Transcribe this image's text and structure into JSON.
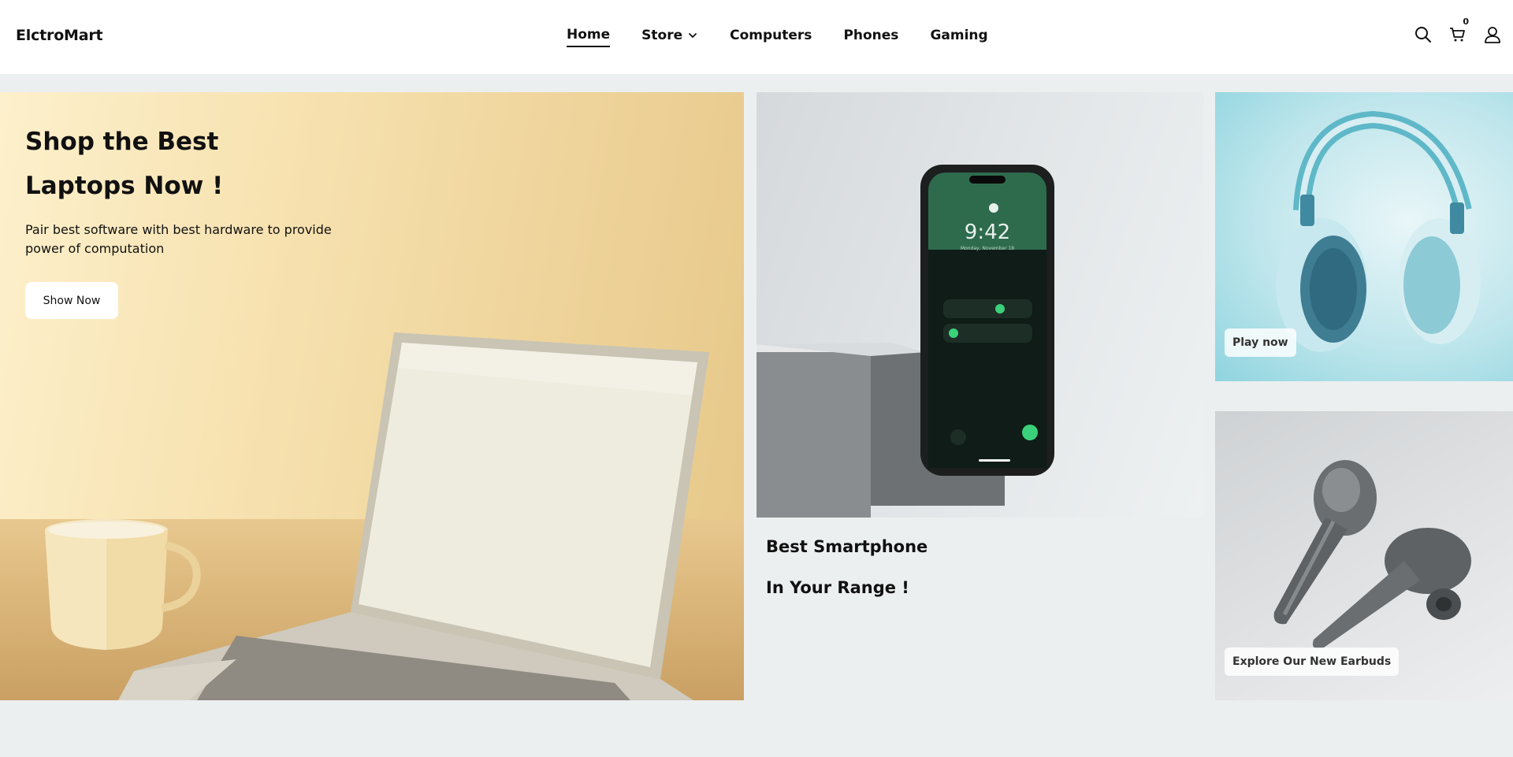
{
  "header": {
    "brand": "ElctroMart",
    "nav": [
      {
        "label": "Home",
        "active": true
      },
      {
        "label": "Store",
        "has_dropdown": true
      },
      {
        "label": "Computers"
      },
      {
        "label": "Phones"
      },
      {
        "label": "Gaming"
      }
    ],
    "icons": [
      "search-icon",
      "cart-icon",
      "user-icon"
    ],
    "cart_count": "0"
  },
  "hero": {
    "title_line1": "Shop the Best",
    "title_line2": "Laptops Now !",
    "description": "Pair best software with best hardware to provide power of computation",
    "button_label": "Show Now"
  },
  "phone_promo": {
    "screen_time": "9:42",
    "screen_date": "Monday, November 18",
    "caption_line1": "Best Smartphone",
    "caption_line2": "In Your Range !"
  },
  "headphones_promo": {
    "label": "Play now"
  },
  "earbuds_promo": {
    "label": "Explore Our New Earbuds"
  },
  "colors": {
    "page_background": "#eceff0",
    "header_background": "#ffffff",
    "text": "#111111",
    "accent_green": "#3ad17a"
  }
}
